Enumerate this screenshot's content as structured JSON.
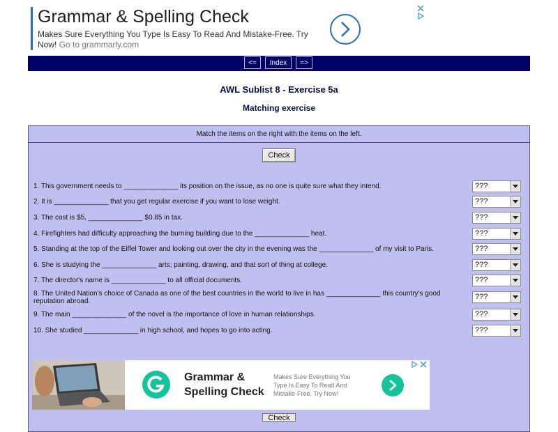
{
  "ad_top": {
    "title": "Grammar & Spelling Check",
    "desc": "Makes Sure Everything You Type Is Easy To Read And Mistake-Free. Try Now!",
    "url": "Go to grammarly.com"
  },
  "nav": {
    "prev": "<=",
    "index": "Index",
    "next": "=>"
  },
  "page": {
    "title": "AWL Sublist 8 - Exercise 5a",
    "subtitle": "Matching exercise",
    "instructions": "Match the items on the right with the items on the left.",
    "check_label": "Check"
  },
  "questions": [
    "1. This government needs to ______________ its position on the issue, as no one is quite sure what they intend.",
    "2. It is ______________ that you get regular exercise if you want to lose weight.",
    "3. The cost is $5, ______________ $0.85 in tax.",
    "4. Firefighters had difficulty approaching the burning building due to the ______________ heat.",
    "5. Standing at the top of the Eiffel Tower and looking out over the city in the evening was the ______________ of my visit to Paris.",
    "6. She is studying the ______________ arts; painting, drawing, and that sort of thing at college.",
    "7. The director's name is ______________ to all official documents.",
    "8. The United Nation's choice of Canada as one of the best countries in the world to live in has ______________ this country's good reputation abroad.",
    "9. The main ______________ of the novel is the importance of love in human relationships.",
    "10. She studied ______________ in high school, and hopes to go into acting."
  ],
  "select_value": "???",
  "ad_bottom": {
    "title": "Grammar & Spelling Check",
    "desc": "Makes Sure Everything You Type Is Easy To Read And Mistake-Free. Try Now!"
  },
  "colors": {
    "nav_bg": "#000066",
    "box_bg": "#c0c0f0",
    "brand_green": "#15c39a",
    "ad_blue": "#2a6fb3"
  }
}
